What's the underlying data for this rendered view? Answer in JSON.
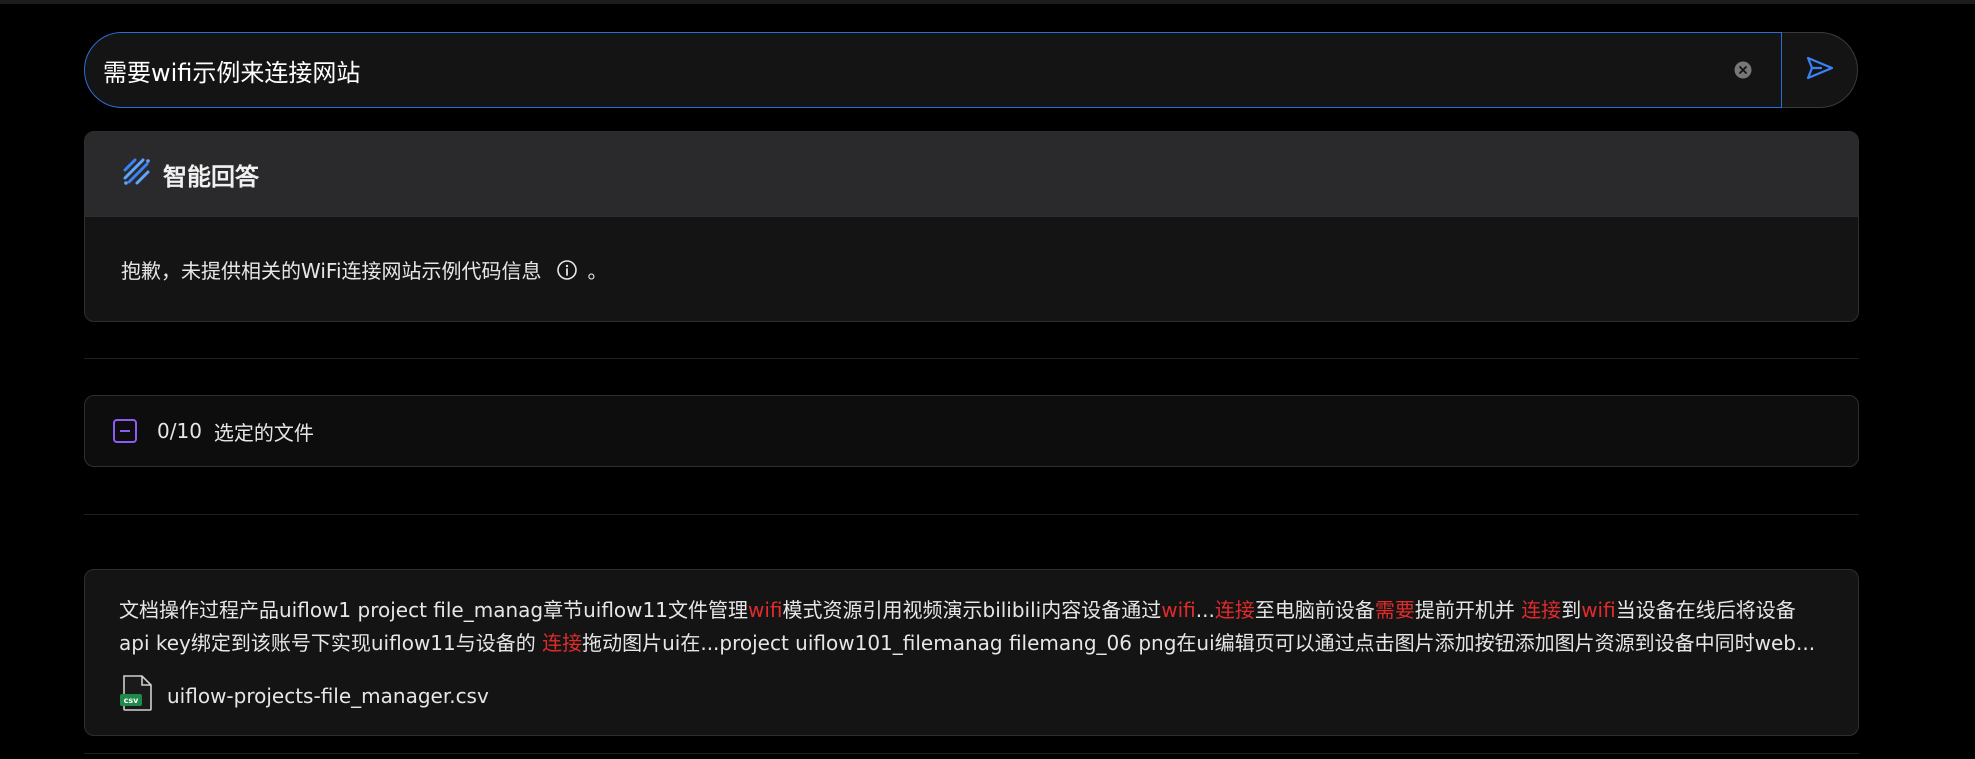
{
  "search": {
    "value": "需要wifi示例来连接网站"
  },
  "answer": {
    "title": "智能回答",
    "text": "抱歉，未提供相关的WiFi连接网站示例代码信息",
    "tail": "。"
  },
  "files": {
    "count": "0/10",
    "label": "选定的文件"
  },
  "result": {
    "line1": [
      {
        "t": "文档操作过程产品uiflow1 project file_manag章节uiflow11文件管理",
        "hl": false
      },
      {
        "t": "wifi",
        "hl": true
      },
      {
        "t": "模式资源引用视频演示bilibili内容设备通过",
        "hl": false
      },
      {
        "t": "wifi",
        "hl": true
      },
      {
        "t": "...",
        "hl": false
      },
      {
        "t": "连接",
        "hl": true
      },
      {
        "t": "至电脑前设备",
        "hl": false
      },
      {
        "t": "需要",
        "hl": true
      },
      {
        "t": "提前开机并 ",
        "hl": false
      },
      {
        "t": "连接",
        "hl": true
      },
      {
        "t": "到",
        "hl": false
      },
      {
        "t": "wifi",
        "hl": true
      },
      {
        "t": "当设备在线后将设备",
        "hl": false
      }
    ],
    "line2": [
      {
        "t": "api key绑定到该账号下实现uiflow11与设备的 ",
        "hl": false
      },
      {
        "t": "连接",
        "hl": true
      },
      {
        "t": "拖动图片ui在...project uiflow101_filemanag filemang_06 png在ui编辑页可以通过点击图片添加按钮添加图片资源到设备中同时web...",
        "hl": false
      }
    ],
    "file_badge": "csv",
    "file_name": "uiflow-projects-file_manager.csv"
  },
  "colors": {
    "accent": "#2b6fd6",
    "highlight": "#e02b2b",
    "checkbox": "#8b5cf6",
    "csv_badge": "#1f8a4c"
  },
  "icons": [
    "clear-icon",
    "send-icon",
    "smart-answer-icon",
    "info-icon",
    "minus-checkbox-icon",
    "csv-file-icon"
  ]
}
